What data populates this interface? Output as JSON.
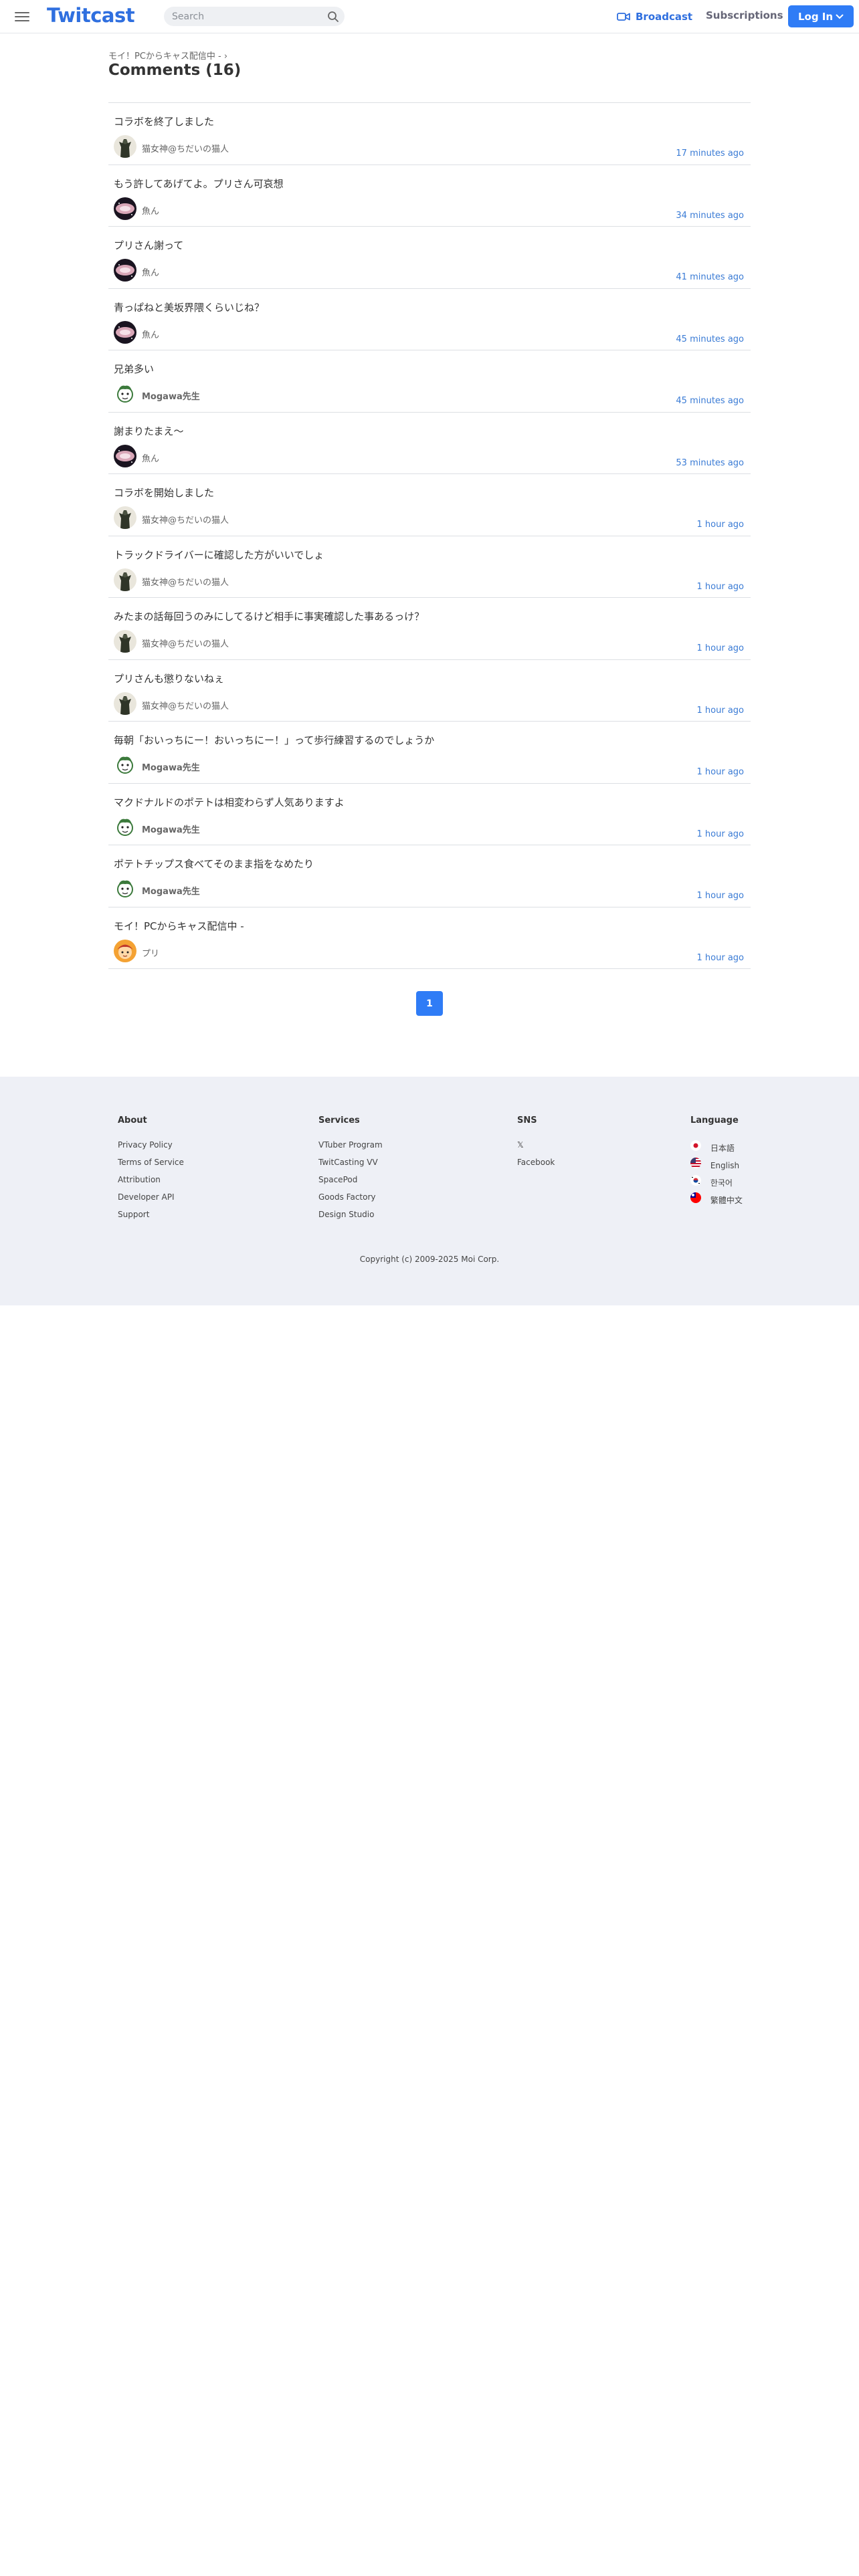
{
  "header": {
    "logo": "Twitcast",
    "search_placeholder": "Search",
    "broadcast_label": "Broadcast",
    "subscriptions_label": "Subscriptions",
    "login_label": "Log In",
    "accent_color": "#2f7cf6"
  },
  "breadcrumb": "モイ！PCからキャス配信中 -  ›",
  "page_title": "Comments (16)",
  "comments": [
    {
      "text": "コラボを終了しました",
      "author": "猫女神@ちだいの猫人",
      "time": "17 minutes ago",
      "avatar": "dark-figure"
    },
    {
      "text": "もう許してあげてよ。プリさん可哀想",
      "author": "魚ん",
      "time": "34 minutes ago",
      "avatar": "pink-nebula"
    },
    {
      "text": "プリさん謝って",
      "author": "魚ん",
      "time": "41 minutes ago",
      "avatar": "pink-nebula"
    },
    {
      "text": "青っぱねと美坂界隈くらいじね？",
      "author": "魚ん",
      "time": "45 minutes ago",
      "avatar": "pink-nebula"
    },
    {
      "text": "兄弟多い",
      "author": "Mogawa先生",
      "time": "45 minutes ago",
      "avatar": "green-cartoon"
    },
    {
      "text": "謝まりたまえ〜",
      "author": "魚ん",
      "time": "53 minutes ago",
      "avatar": "pink-nebula"
    },
    {
      "text": "コラボを開始しました",
      "author": "猫女神@ちだいの猫人",
      "time": "1 hour ago",
      "avatar": "dark-figure"
    },
    {
      "text": "トラックドライバーに確認した方がいいでしょ",
      "author": "猫女神@ちだいの猫人",
      "time": "1 hour ago",
      "avatar": "dark-figure"
    },
    {
      "text": "みたまの話毎回うのみにしてるけど相手に事実確認した事あるっけ？",
      "author": "猫女神@ちだいの猫人",
      "time": "1 hour ago",
      "avatar": "dark-figure"
    },
    {
      "text": "プリさんも懲りないねぇ",
      "author": "猫女神@ちだいの猫人",
      "time": "1 hour ago",
      "avatar": "dark-figure"
    },
    {
      "text": "毎朝「おいっちにー！おいっちにー！」って歩行練習するのでしょうか",
      "author": "Mogawa先生",
      "time": "1 hour ago",
      "avatar": "green-cartoon"
    },
    {
      "text": "マクドナルドのポテトは相変わらず人気ありますよ",
      "author": "Mogawa先生",
      "time": "1 hour ago",
      "avatar": "green-cartoon"
    },
    {
      "text": "ポテトチップス食べてそのまま指をなめたり",
      "author": "Mogawa先生",
      "time": "1 hour ago",
      "avatar": "green-cartoon"
    },
    {
      "text": "モイ！PCからキャス配信中 -",
      "author": "プリ",
      "time": "1 hour ago",
      "avatar": "orange-character"
    }
  ],
  "pagination": {
    "current": "1"
  },
  "footer": {
    "about": {
      "title": "About",
      "links": [
        "Privacy Policy",
        "Terms of Service",
        "Attribution",
        "Developer API",
        "Support"
      ]
    },
    "services": {
      "title": "Services",
      "links": [
        "VTuber Program",
        "TwitCasting VV",
        "SpacePod",
        "Goods Factory",
        "Design Studio"
      ]
    },
    "sns": {
      "title": "SNS",
      "links": [
        "𝕏",
        "Facebook"
      ]
    },
    "language": {
      "title": "Language",
      "links": [
        "日本語",
        "English",
        "한국어",
        "繁體中文"
      ]
    },
    "copyright": "Copyright (c) 2009-2025 Moi Corp."
  }
}
